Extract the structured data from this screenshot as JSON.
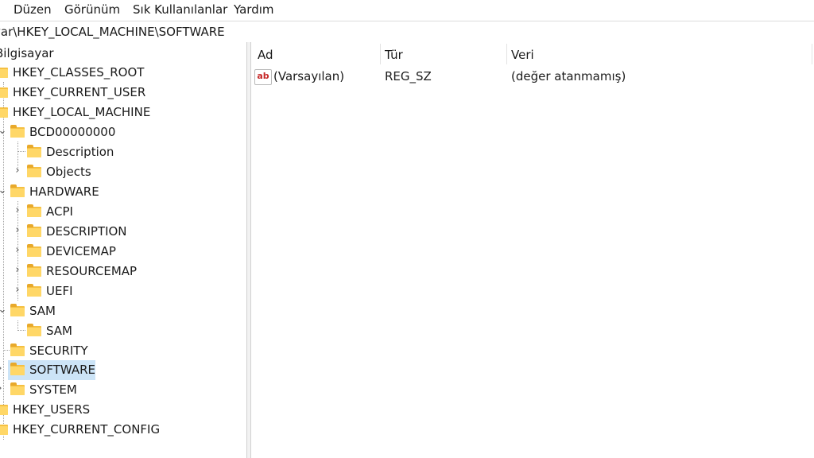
{
  "menu": [
    "Düzen",
    "Görünüm",
    "Sık Kullanılanlar",
    "Yardım"
  ],
  "address": "yar\\HKEY_LOCAL_MACHINE\\SOFTWARE",
  "tree": {
    "root": "Bilgisayar",
    "hkcr": "HKEY_CLASSES_ROOT",
    "hkcu": "HKEY_CURRENT_USER",
    "hklm": "HKEY_LOCAL_MACHINE",
    "bcd": "BCD00000000",
    "bcd_description": "Description",
    "bcd_objects": "Objects",
    "hardware": "HARDWARE",
    "acpi": "ACPI",
    "hw_description": "DESCRIPTION",
    "devicemap": "DEVICEMAP",
    "resourcemap": "RESOURCEMAP",
    "uefi": "UEFI",
    "sam": "SAM",
    "sam_child": "SAM",
    "security": "SECURITY",
    "software": "SOFTWARE",
    "system": "SYSTEM",
    "hku": "HKEY_USERS",
    "hkcc": "HKEY_CURRENT_CONFIG"
  },
  "list": {
    "columns": [
      "Ad",
      "Tür",
      "Veri"
    ],
    "rows": [
      {
        "icon": "ab",
        "name": "(Varsayılan)",
        "type": "REG_SZ",
        "data": "(değer atanmamış)"
      }
    ]
  }
}
